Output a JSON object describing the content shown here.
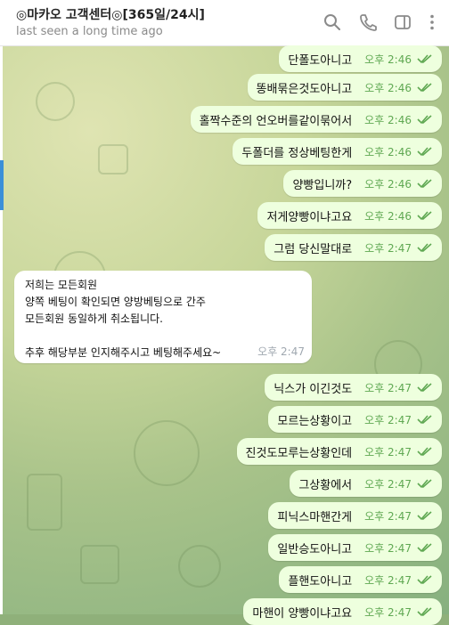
{
  "header": {
    "title": "◎마카오 고객센터◎[365일/24시]",
    "status": "last seen a long time ago",
    "icons": [
      "search-icon",
      "phone-icon",
      "sidebar-toggle-icon",
      "more-icon"
    ]
  },
  "colors": {
    "outgoing_bubble": "#eeffde",
    "incoming_bubble": "#ffffff",
    "time_outgoing": "#5fa852",
    "accent": "#3a8fd8"
  },
  "messages_top": [
    {
      "text": "단폴도아니고",
      "time": "오후 2:46"
    },
    {
      "text": "똥배묶은것도아니고",
      "time": "오후 2:46"
    },
    {
      "text": "홀짝수준의 언오버를같이묶어서",
      "time": "오후 2:46"
    },
    {
      "text": "두폴더를 정상베팅한게",
      "time": "오후 2:46"
    },
    {
      "text": "양빵입니까?",
      "time": "오후 2:46"
    },
    {
      "text": "저게양빵이냐고요",
      "time": "오후 2:46"
    },
    {
      "text": "그럼 당신말대로",
      "time": "오후 2:47"
    }
  ],
  "incoming": {
    "lines": [
      "저희는 모든회원",
      "양쪽 베팅이 확인되면 양방베팅으로 간주",
      "모든회원 동일하게 취소됩니다.",
      "",
      "추후 해당부분 인지해주시고 베팅해주세요~"
    ],
    "time": "오후 2:47"
  },
  "messages_bottom": [
    {
      "text": "닉스가 이긴것도",
      "time": "오후 2:47"
    },
    {
      "text": "모르는상황이고",
      "time": "오후 2:47"
    },
    {
      "text": "진것도모루는상황인데",
      "time": "오후 2:47"
    },
    {
      "text": "그상황에서",
      "time": "오후 2:47"
    },
    {
      "text": "피닉스마핸간게",
      "time": "오후 2:47"
    },
    {
      "text": "일반승도아니고",
      "time": "오후 2:47"
    },
    {
      "text": "플핸도아니고",
      "time": "오후 2:47"
    },
    {
      "text": "마핸이 양빵이냐고요",
      "time": "오후 2:47"
    }
  ]
}
